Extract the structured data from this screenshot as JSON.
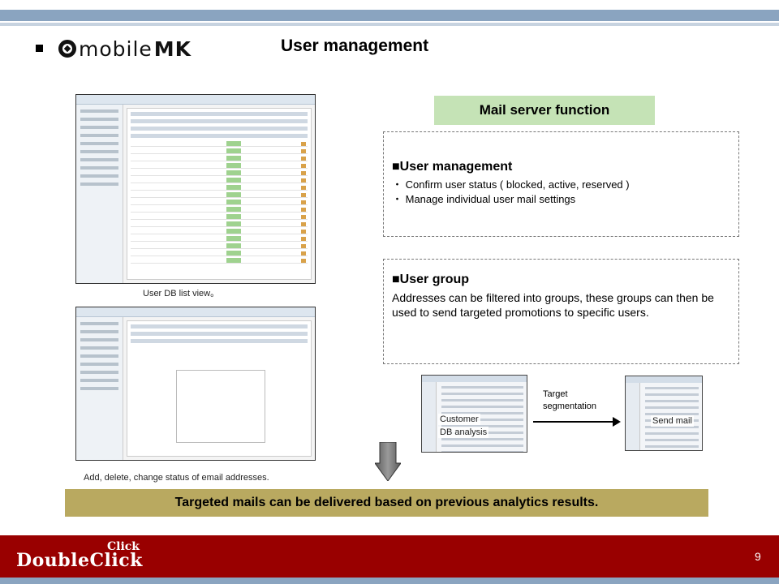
{
  "header": {
    "logo_text_main": "mobile",
    "logo_text_accent": "MK",
    "title": "User management"
  },
  "screenshots": {
    "list_caption": "User DB list view。",
    "edit_caption": "Add, delete, change status of email addresses."
  },
  "mail_server": {
    "heading": "Mail server function",
    "user_management": {
      "title": "■User management",
      "items": [
        "・ Confirm user status ( blocked, active, reserved )",
        "・ Manage individual user mail settings"
      ]
    },
    "user_group": {
      "title": "■User group",
      "text": "Addresses can be filtered into groups, these groups can then be used to send targeted promotions to specific users."
    }
  },
  "flow": {
    "customer_label_1": "Customer",
    "customer_label_2": "DB analysis",
    "arrow_label_1": "Target",
    "arrow_label_2": "segmentation",
    "send_label": "Send mail"
  },
  "banner": "Targeted mails can be delivered based on previous analytics results.",
  "footer": {
    "logo_small": "Click",
    "logo_big": "DoubleClick",
    "page_number": "9"
  },
  "colors": {
    "mail_heading_bg": "#c5e3b6",
    "banner_bg": "#b9a960",
    "footer_bg": "#990000",
    "top_band": "#8aa4c0"
  }
}
